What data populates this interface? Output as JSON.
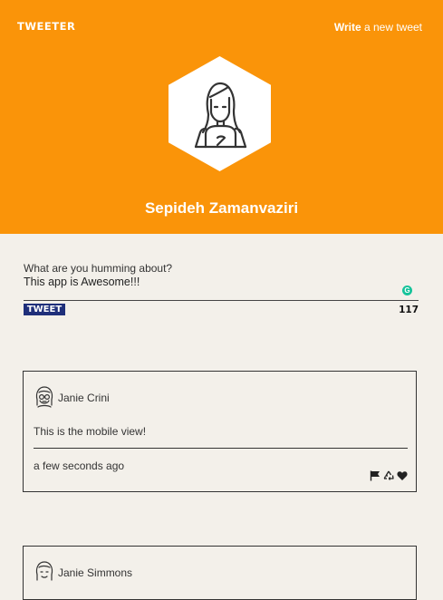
{
  "header": {
    "brand": "TWEETER",
    "write_bold": "Write",
    "write_rest": " a new tweet",
    "user_name": "Sepideh Zamanvaziri",
    "background_color": "#fa9409"
  },
  "compose": {
    "label": "What are you humming about?",
    "text": "This app is Awesome!!!",
    "tweet_button": "TWEET",
    "char_count": "117",
    "button_color": "#1f2f7a"
  },
  "tweets": [
    {
      "author": "Janie Crini",
      "text": "This is the mobile view!",
      "time": "a few seconds ago",
      "actions": [
        "flag-icon",
        "retweet-icon",
        "heart-icon"
      ]
    },
    {
      "author": "Janie Simmons"
    }
  ]
}
